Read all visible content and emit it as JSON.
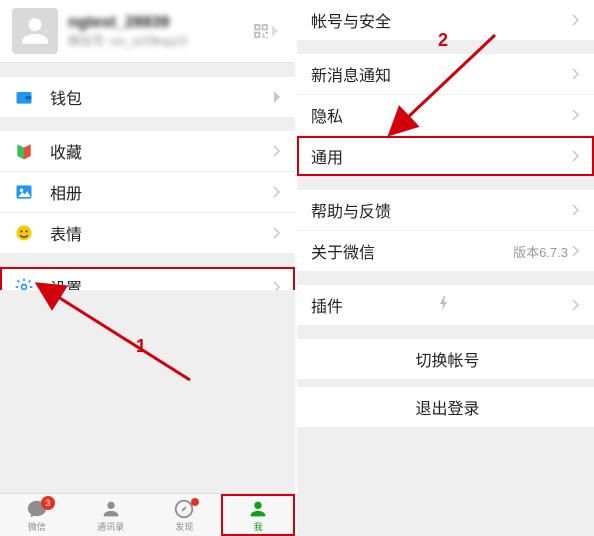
{
  "profile": {
    "name": "ngtest_28839",
    "id": "微信号: wx_a2t9kqq15"
  },
  "left": {
    "wallet": "钱包",
    "favorites": "收藏",
    "album": "相册",
    "sticker": "表情",
    "settings": "设置"
  },
  "tabs": {
    "chat": "微信",
    "contacts": "通讯录",
    "discover": "发现",
    "me": "我",
    "badge": "3"
  },
  "right": {
    "account": "帐号与安全",
    "new_message": "新消息通知",
    "privacy": "隐私",
    "general": "通用",
    "help": "帮助与反馈",
    "about": "关于微信",
    "about_version": "版本6.7.3",
    "plugins": "插件",
    "switch": "切换帐号",
    "logout": "退出登录"
  },
  "annotations": {
    "step1": "1",
    "step2": "2"
  }
}
